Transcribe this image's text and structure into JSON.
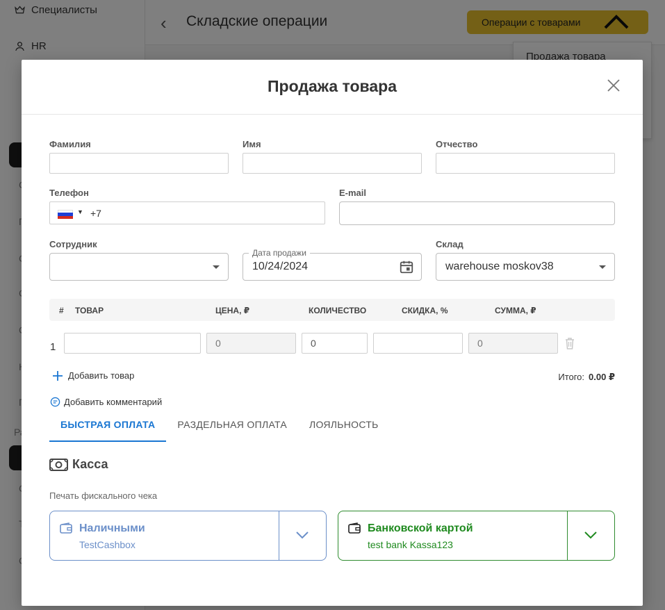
{
  "sidebar": {
    "items": [
      {
        "label": "Специалисты",
        "icon": "crown-icon"
      },
      {
        "label": "HR",
        "icon": "user-icon"
      }
    ],
    "clipped_chars": [
      "С",
      "П",
      "С",
      "С",
      "С",
      "К",
      "П",
      "Ра",
      "С",
      "Т",
      "С"
    ]
  },
  "header": {
    "title": "Складские операции",
    "operations_button": "Операции с товарами",
    "operations_menu": [
      "Продажа товара"
    ]
  },
  "modal": {
    "title": "Продажа товара",
    "fields": {
      "last_name_label": "Фамилия",
      "first_name_label": "Имя",
      "middle_name_label": "Отчество",
      "phone_label": "Телефон",
      "phone_code": "+7",
      "email_label": "E-mail",
      "employee_label": "Сотрудник",
      "employee_value": "",
      "sale_date_label": "Дата продажи",
      "sale_date_value": "10/24/2024",
      "warehouse_label": "Склад",
      "warehouse_value": "warehouse moskov38"
    },
    "table": {
      "headers": [
        "#",
        "ТОВАР",
        "ЦЕНА, ₽",
        "КОЛИЧЕСТВО",
        "СКИДКА, %",
        "СУММА, ₽"
      ],
      "rows": [
        {
          "num": "1",
          "product": "",
          "price": "0",
          "quantity": "0",
          "discount": "",
          "sum": "0"
        }
      ]
    },
    "add_item": "Добавить товар",
    "total_label": "Итого:",
    "total_value": "0.00 ₽",
    "add_comment": "Добавить комментарий",
    "tabs": [
      "БЫСТРАЯ ОПЛАТА",
      "РАЗДЕЛЬНАЯ ОПЛАТА",
      "ЛОЯЛЬНОСТЬ"
    ],
    "active_tab": 0,
    "kassa_title": "Касса",
    "fiscal_label": "Печать фискального чека",
    "payments": [
      {
        "name": "Наличными",
        "sub": "TestCashbox",
        "color": "#6b8fc9"
      },
      {
        "name": "Банковской картой",
        "sub": "test bank Kassa123",
        "color": "#1f8a1f"
      }
    ]
  },
  "colors": {
    "accent_yellow": "#e8c12c",
    "tab_blue": "#1976d2",
    "cash_blue": "#6b8fc9",
    "card_green": "#1f8a1f"
  }
}
